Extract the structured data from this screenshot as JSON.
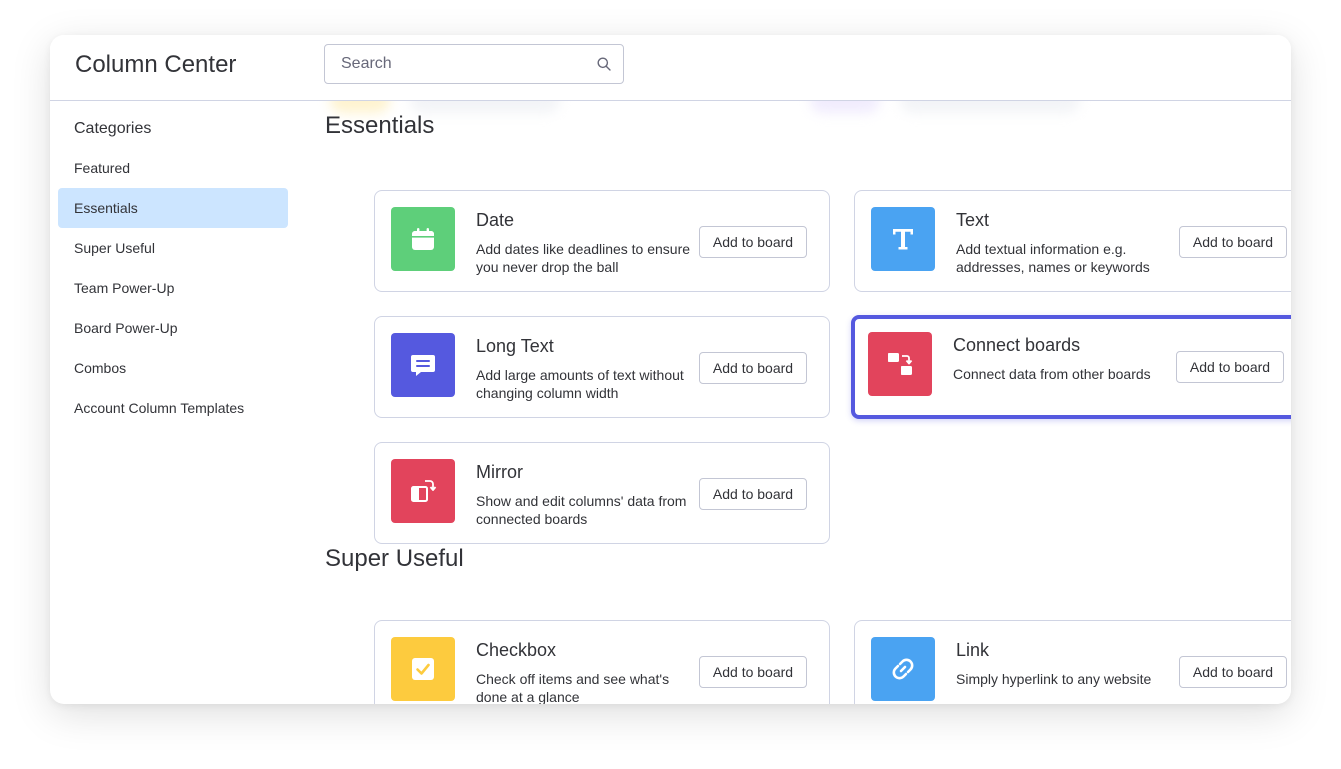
{
  "header": {
    "title": "Column Center",
    "search_placeholder": "Search"
  },
  "sidebar": {
    "heading": "Categories",
    "items": [
      {
        "label": "Featured",
        "active": false
      },
      {
        "label": "Essentials",
        "active": true
      },
      {
        "label": "Super Useful",
        "active": false
      },
      {
        "label": "Team Power-Up",
        "active": false
      },
      {
        "label": "Board Power-Up",
        "active": false
      },
      {
        "label": "Combos",
        "active": false
      },
      {
        "label": "Account Column Templates",
        "active": false
      }
    ]
  },
  "sections": [
    {
      "title": "Essentials",
      "cards": [
        {
          "title": "Date",
          "description": "Add dates like deadlines to ensure you never drop the ball",
          "icon": "calendar-icon",
          "color": "#5ecf7a",
          "button": "Add to board"
        },
        {
          "title": "Text",
          "description": "Add textual information e.g. addresses, names or keywords",
          "icon": "text-t-icon",
          "color": "#4aa3f2",
          "button": "Add to board"
        },
        {
          "title": "Long Text",
          "description": "Add large amounts of text without changing column width",
          "icon": "chat-bubble-icon",
          "color": "#5559df",
          "button": "Add to board"
        },
        {
          "title": "Connect boards",
          "description": "Connect data from other boards",
          "icon": "connect-boards-icon",
          "color": "#e2445c",
          "button": "Add to board",
          "highlighted": true
        },
        {
          "title": "Mirror",
          "description": "Show and edit columns' data from connected boards",
          "icon": "mirror-icon",
          "color": "#e2445c",
          "button": "Add to board"
        }
      ]
    },
    {
      "title": "Super Useful",
      "cards": [
        {
          "title": "Checkbox",
          "description": "Check off items and see what's done at a glance",
          "icon": "checkbox-icon",
          "color": "#fdcb3e",
          "button": "Add to board"
        },
        {
          "title": "Link",
          "description": "Simply hyperlink to any website",
          "icon": "link-icon",
          "color": "#4aa3f2",
          "button": "Add to board"
        }
      ]
    }
  ],
  "colors": {
    "accent": "#5559df",
    "active_category": "#cce5ff",
    "border": "#d0d4e4"
  }
}
